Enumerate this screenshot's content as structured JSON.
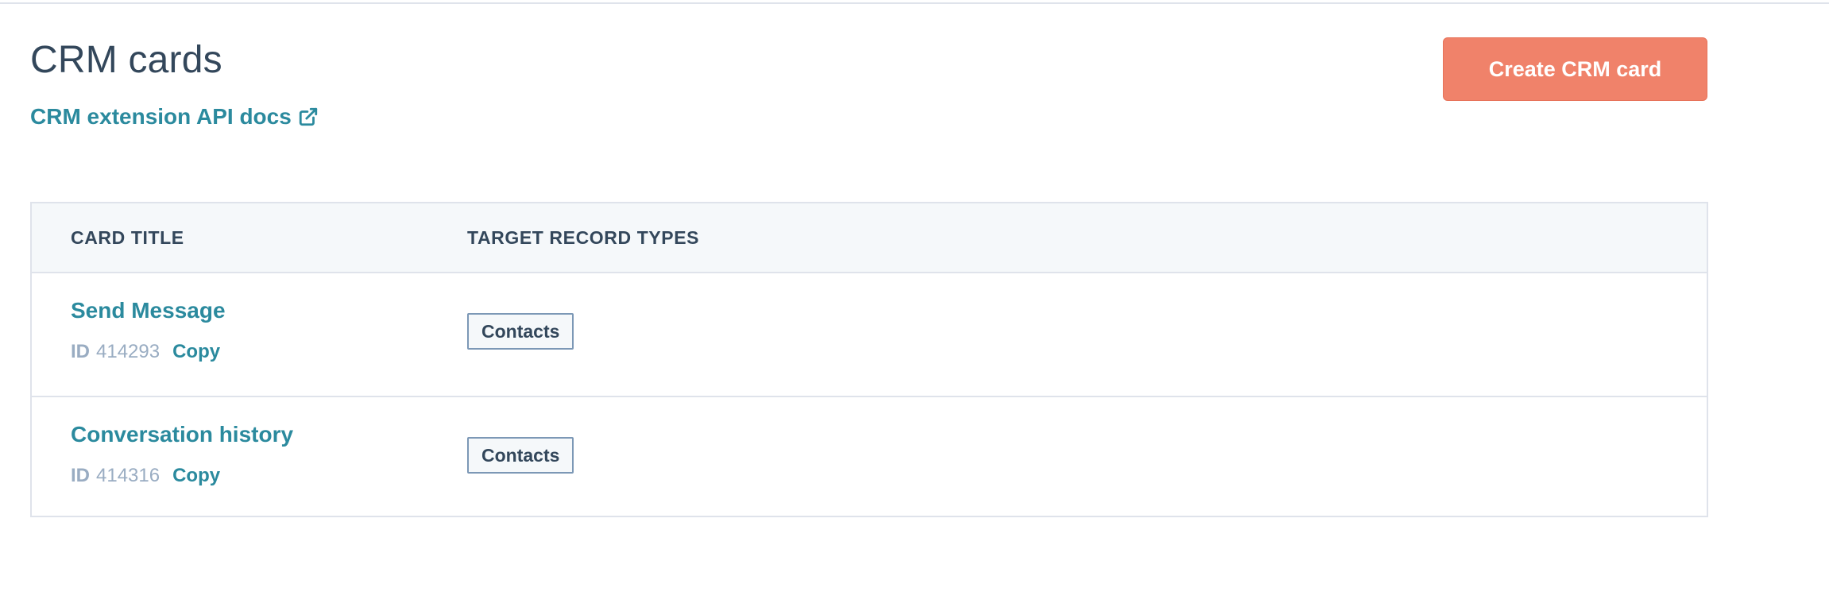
{
  "header": {
    "title": "CRM cards",
    "docs_link_label": "CRM extension API docs",
    "create_button_label": "Create CRM card"
  },
  "table": {
    "columns": [
      "CARD TITLE",
      "TARGET RECORD TYPES"
    ],
    "rows": [
      {
        "title": "Send Message",
        "id_label": "ID",
        "id_value": "414293",
        "copy_label": "Copy",
        "record_type": "Contacts"
      },
      {
        "title": "Conversation history",
        "id_label": "ID",
        "id_value": "414316",
        "copy_label": "Copy",
        "record_type": "Contacts"
      }
    ]
  },
  "icons": {
    "external_link": "external-link-icon"
  },
  "colors": {
    "accent_link": "#2b8a9e",
    "primary_button": "#f0826a",
    "text_dark": "#33475b",
    "text_muted": "#99acc2",
    "border": "#dfe3eb",
    "header_bg": "#f5f8fa"
  }
}
